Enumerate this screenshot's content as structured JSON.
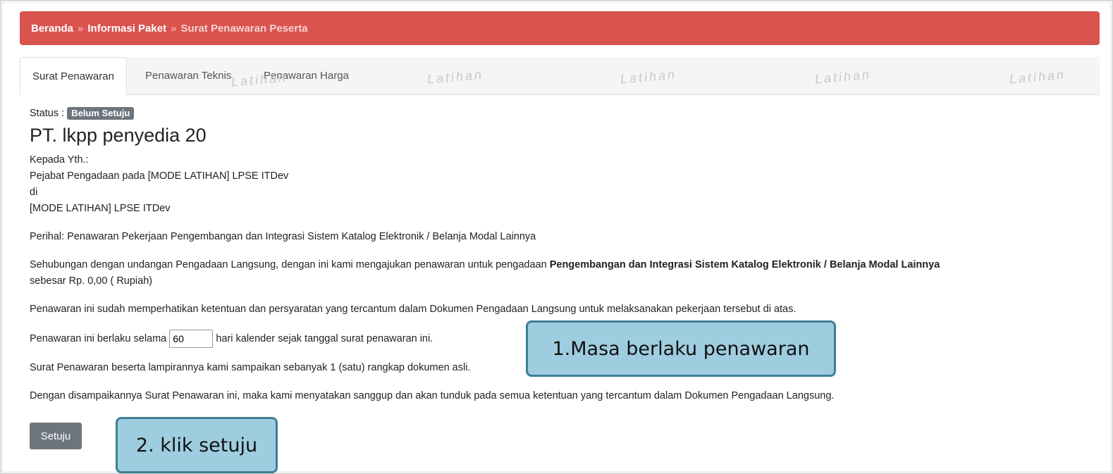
{
  "breadcrumb": {
    "items": [
      "Beranda",
      "Informasi Paket",
      "Surat Penawaran Peserta"
    ],
    "separator": "»"
  },
  "tabs": [
    "Surat Penawaran",
    "Penawaran Teknis",
    "Penawaran Harga"
  ],
  "watermark": "Latihan",
  "status": {
    "label": "Status :",
    "badge": "Belum Setuju"
  },
  "company": "PT. lkpp penyedia 20",
  "recipient": {
    "line1": "Kepada Yth.:",
    "line2": "Pejabat Pengadaan pada [MODE LATIHAN] LPSE ITDev",
    "line3": "di",
    "line4": "[MODE LATIHAN] LPSE ITDev"
  },
  "perihal": "Perihal: Penawaran Pekerjaan Pengembangan dan Integrasi Sistem Katalog Elektronik / Belanja Modal Lainnya",
  "sehubungan": {
    "prefix": "Sehubungan dengan undangan Pengadaan Langsung, dengan ini kami mengajukan penawaran untuk pengadaan ",
    "bold": "Pengembangan dan Integrasi Sistem Katalog Elektronik / Belanja Modal Lainnya",
    "suffix": "sebesar Rp. 0,00 ( Rupiah)"
  },
  "penawaran_note": "Penawaran ini sudah memperhatikan ketentuan dan persyaratan yang tercantum dalam Dokumen Pengadaan Langsung untuk melaksanakan pekerjaan tersebut di atas.",
  "masa_berlaku": {
    "prefix": "Penawaran ini berlaku selama",
    "value": "60",
    "suffix": "hari kalender sejak tanggal surat penawaran ini."
  },
  "lampiran": "Surat Penawaran beserta lampirannya kami sampaikan sebanyak 1 (satu) rangkap dokumen asli.",
  "pernyataan": "Dengan disampaikannya Surat Penawaran ini, maka kami menyatakan sanggup dan akan tunduk pada semua ketentuan yang tercantum dalam Dokumen Pengadaan Langsung.",
  "button": "Setuju",
  "callouts": [
    "1.Masa berlaku penawaran",
    "2. klik setuju"
  ],
  "colors": {
    "breadcrumb": "#d9534f",
    "badge": "#6c757d",
    "callout_fill": "#9fcde0",
    "callout_border": "#3e7f97"
  }
}
